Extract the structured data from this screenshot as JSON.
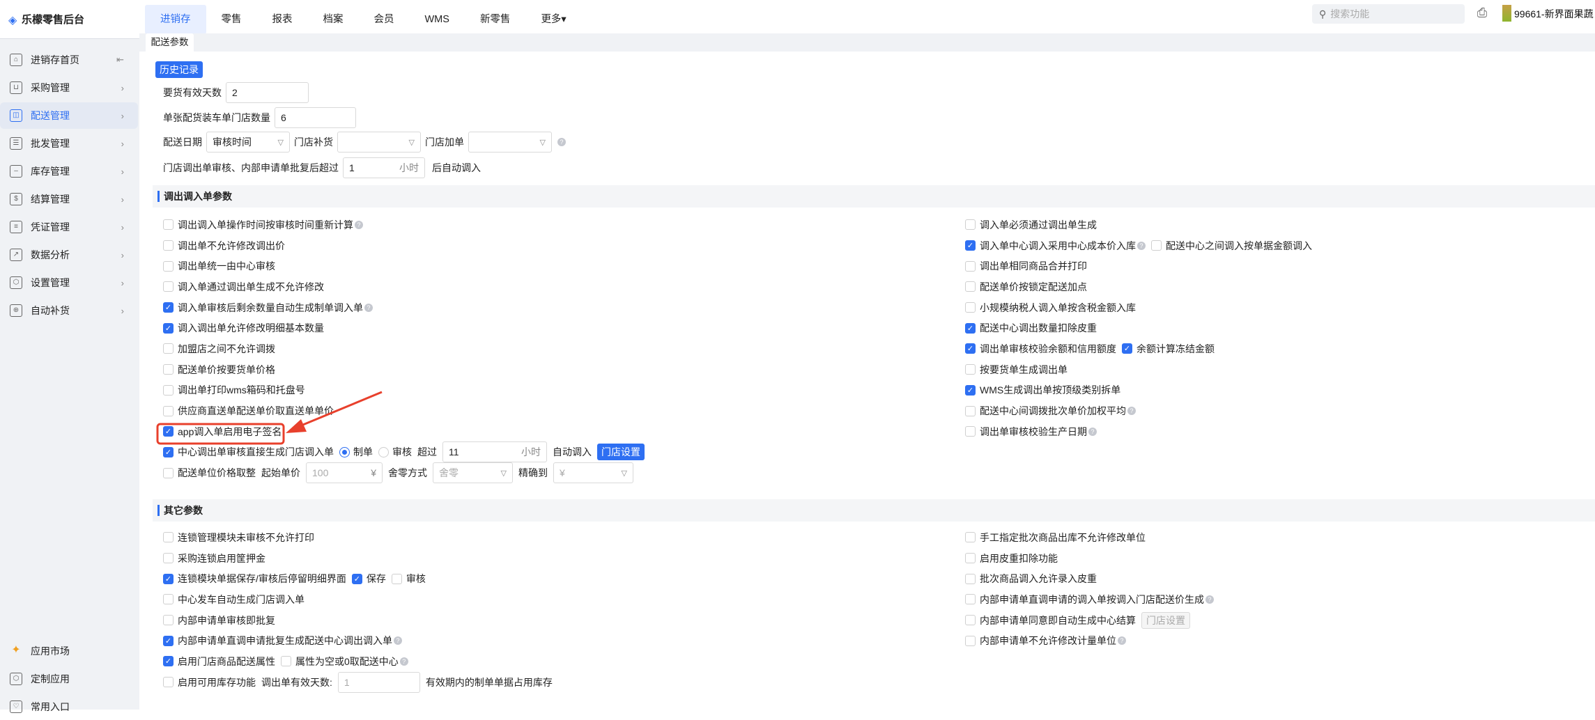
{
  "header": {
    "app_title": "乐檬零售后台",
    "nav": [
      "进销存",
      "零售",
      "报表",
      "档案",
      "会员",
      "WMS",
      "新零售",
      "更多▾"
    ],
    "search_placeholder": "搜索功能",
    "user": "99661-新界面果蔬"
  },
  "sidebar": {
    "items": [
      {
        "label": "进销存首页",
        "icon": "home-icon"
      },
      {
        "label": "采购管理",
        "icon": "cart-icon"
      },
      {
        "label": "配送管理",
        "icon": "delivery-icon"
      },
      {
        "label": "批发管理",
        "icon": "wholesale-icon"
      },
      {
        "label": "库存管理",
        "icon": "inventory-icon"
      },
      {
        "label": "结算管理",
        "icon": "dollar-icon"
      },
      {
        "label": "凭证管理",
        "icon": "document-icon"
      },
      {
        "label": "数据分析",
        "icon": "chart-icon"
      },
      {
        "label": "设置管理",
        "icon": "settings-icon"
      },
      {
        "label": "自动补货",
        "icon": "replenish-icon"
      }
    ],
    "bottom": [
      {
        "label": "应用市场",
        "icon": "app-market-icon"
      },
      {
        "label": "定制应用",
        "icon": "cube-icon"
      },
      {
        "label": "常用入口",
        "icon": "heart-icon"
      }
    ]
  },
  "tab": "配送参数",
  "top": {
    "history_button": "历史记录",
    "valid_days_label": "要货有效天数",
    "valid_days": "2",
    "store_count_label": "单张配货装车单门店数量",
    "store_count": "6",
    "date_label": "配送日期",
    "date_value": "审核时间",
    "replenish_label": "门店补货",
    "add_label": "门店加单",
    "auto_label": "门店调出单审核、内部申请单批复后超过",
    "auto_value": "1",
    "auto_unit": "小时",
    "auto_suffix": "后自动调入"
  },
  "section1": {
    "title": "调出调入单参数",
    "left": [
      [
        {
          "t": "cb",
          "on": false,
          "label": "调出调入单操作时间按审核时间重新计算",
          "help": true
        }
      ],
      [
        {
          "t": "cb",
          "on": false,
          "label": "调出单不允许修改调出价"
        }
      ],
      [
        {
          "t": "cb",
          "on": false,
          "label": "调出单统一由中心审核"
        }
      ],
      [
        {
          "t": "cb",
          "on": false,
          "label": "调入单通过调出单生成不允许修改"
        }
      ],
      [
        {
          "t": "cb",
          "on": true,
          "label": "调入单审核后剩余数量自动生成制单调入单",
          "help": true
        }
      ],
      [
        {
          "t": "cb",
          "on": true,
          "label": "调入调出单允许修改明细基本数量"
        }
      ],
      [
        {
          "t": "cb",
          "on": false,
          "label": "加盟店之间不允许调拨"
        }
      ],
      [
        {
          "t": "cb",
          "on": false,
          "label": "配送单价按要货单价格"
        }
      ],
      [
        {
          "t": "cb",
          "on": false,
          "label": "调出单打印wms箱码和托盘号"
        }
      ],
      [
        {
          "t": "cb",
          "on": false,
          "label": "供应商直送单配送单价取直送单单价"
        }
      ],
      [
        {
          "t": "cb",
          "on": true,
          "label": "app调入单启用电子签名"
        }
      ],
      [
        {
          "t": "cb",
          "on": true,
          "label": "中心调出单审核直接生成门店调入单"
        },
        {
          "t": "radio",
          "on": true,
          "label": "制单"
        },
        {
          "t": "radio",
          "on": false,
          "label": "审核"
        },
        {
          "t": "text",
          "label": "超过"
        },
        {
          "t": "input",
          "value": "11",
          "suffix": "小时",
          "w": 150
        },
        {
          "t": "text",
          "label": "自动调入"
        },
        {
          "t": "button",
          "label": "门店设置"
        }
      ],
      [
        {
          "t": "cb",
          "on": false,
          "label": "配送单位价格取整"
        },
        {
          "t": "text",
          "label": "起始单价"
        },
        {
          "t": "input",
          "value": "100",
          "suffix": "¥",
          "w": 110,
          "dis": true
        },
        {
          "t": "text",
          "label": "舍零方式"
        },
        {
          "t": "select",
          "value": "舍零",
          "w": 115,
          "dis": true
        },
        {
          "t": "text",
          "label": "精确到"
        },
        {
          "t": "select",
          "value": "¥",
          "w": 115,
          "dis": true
        }
      ]
    ],
    "right": [
      [
        {
          "t": "cb",
          "on": false,
          "label": "调入单必须通过调出单生成"
        }
      ],
      [
        {
          "t": "cb",
          "on": true,
          "label": "调入单中心调入采用中心成本价入库",
          "help": true
        },
        {
          "t": "cb",
          "on": false,
          "label": "配送中心之间调入按单据金额调入"
        }
      ],
      [
        {
          "t": "cb",
          "on": false,
          "label": "调出单相同商品合并打印"
        }
      ],
      [
        {
          "t": "cb",
          "on": false,
          "label": "配送单价按锁定配送加点"
        }
      ],
      [
        {
          "t": "cb",
          "on": false,
          "label": "小规模纳税人调入单按含税金额入库"
        }
      ],
      [
        {
          "t": "cb",
          "on": true,
          "label": "配送中心调出数量扣除皮重"
        }
      ],
      [
        {
          "t": "cb",
          "on": true,
          "label": "调出单审核校验余额和信用额度"
        },
        {
          "t": "cb",
          "on": true,
          "label": "余额计算冻结金额"
        }
      ],
      [
        {
          "t": "cb",
          "on": false,
          "label": "按要货单生成调出单"
        }
      ],
      [
        {
          "t": "cb",
          "on": true,
          "label": "WMS生成调出单按顶级类别拆单"
        }
      ],
      [
        {
          "t": "cb",
          "on": false,
          "label": "配送中心间调拨批次单价加权平均",
          "help": true
        }
      ],
      [
        {
          "t": "cb",
          "on": false,
          "label": "调出单审核校验生产日期",
          "help": true
        }
      ]
    ]
  },
  "section2": {
    "title": "其它参数",
    "left": [
      [
        {
          "t": "cb",
          "on": false,
          "label": "连锁管理模块未审核不允许打印"
        }
      ],
      [
        {
          "t": "cb",
          "on": false,
          "label": "采购连锁启用筐押金"
        }
      ],
      [
        {
          "t": "cb",
          "on": true,
          "label": "连锁模块单据保存/审核后停留明细界面"
        },
        {
          "t": "cb",
          "on": true,
          "label": "保存"
        },
        {
          "t": "cb",
          "on": false,
          "label": "审核"
        }
      ],
      [
        {
          "t": "cb",
          "on": false,
          "label": "中心发车自动生成门店调入单"
        }
      ],
      [
        {
          "t": "cb",
          "on": false,
          "label": "内部申请单审核即批复"
        }
      ],
      [
        {
          "t": "cb",
          "on": true,
          "label": "内部申请单直调申请批复生成配送中心调出调入单",
          "help": true
        }
      ],
      [
        {
          "t": "cb",
          "on": true,
          "label": "启用门店商品配送属性"
        },
        {
          "t": "cb",
          "on": false,
          "label": "属性为空或0取配送中心",
          "help": true
        }
      ],
      [
        {
          "t": "cb",
          "on": false,
          "label": "启用可用库存功能"
        },
        {
          "t": "text",
          "label": "调出单有效天数:"
        },
        {
          "t": "input",
          "value": "1",
          "suffix": "",
          "w": 118,
          "dis": true
        },
        {
          "t": "text",
          "label": "有效期内的制单单据占用库存"
        }
      ]
    ],
    "right": [
      [
        {
          "t": "cb",
          "on": false,
          "label": "手工指定批次商品出库不允许修改单位"
        }
      ],
      [
        {
          "t": "cb",
          "on": false,
          "label": "启用皮重扣除功能"
        }
      ],
      [
        {
          "t": "cb",
          "on": false,
          "label": "批次商品调入允许录入皮重"
        }
      ],
      [
        {
          "t": "cb",
          "on": false,
          "label": "内部申请单直调申请的调入单按调入门店配送价生成",
          "help": true
        }
      ],
      [
        {
          "t": "cb",
          "on": false,
          "label": "内部申请单同意即自动生成中心结算"
        },
        {
          "t": "button",
          "label": "门店设置",
          "dis": true
        }
      ],
      [
        {
          "t": "cb",
          "on": false,
          "label": "内部申请单不允许修改计量单位",
          "help": true
        }
      ]
    ]
  },
  "colors": {
    "accent": "#2e6ff2",
    "highlight": "#e8402c",
    "sidebar_bg": "#f0f2f5"
  }
}
